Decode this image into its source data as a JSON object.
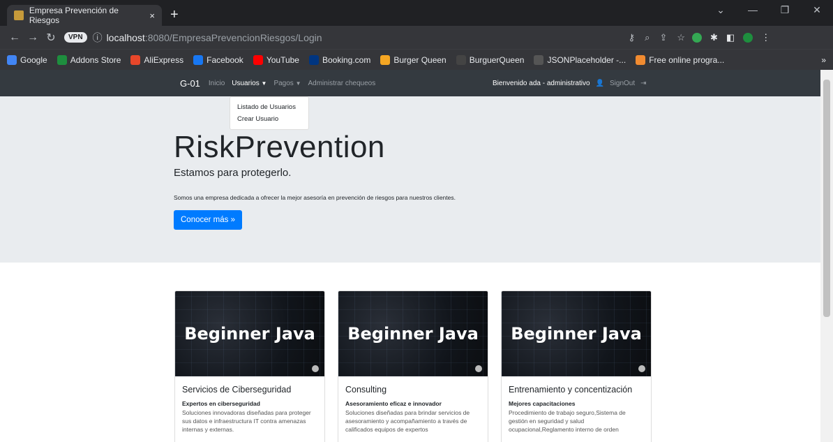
{
  "browser": {
    "tab_title": "Empresa Prevención de Riesgos",
    "tab_close": "×",
    "new_tab": "+",
    "url_host": "localhost",
    "url_path": ":8080/EmpresaPrevencionRiesgos/Login",
    "vpn_label": "VPN",
    "bookmarks": [
      {
        "label": "Google",
        "icon": "google-icon",
        "color": "#4285f4"
      },
      {
        "label": "Addons Store",
        "icon": "addons-icon",
        "color": "#1e8e3e"
      },
      {
        "label": "AliExpress",
        "icon": "aliexpress-icon",
        "color": "#e8472a"
      },
      {
        "label": "Facebook",
        "icon": "facebook-icon",
        "color": "#1877f2"
      },
      {
        "label": "YouTube",
        "icon": "youtube-icon",
        "color": "#ff0000"
      },
      {
        "label": "Booking.com",
        "icon": "booking-icon",
        "color": "#003580"
      },
      {
        "label": "Burger Queen",
        "icon": "burger-icon",
        "color": "#f5a623"
      },
      {
        "label": "BurguerQueen",
        "icon": "angular-icon",
        "color": "#444"
      },
      {
        "label": "JSONPlaceholder -...",
        "icon": "json-icon",
        "color": "#555"
      },
      {
        "label": "Free online progra...",
        "icon": "freecode-icon",
        "color": "#f28b30"
      }
    ],
    "more_bookmarks": "»"
  },
  "nav": {
    "brand": "G-01",
    "items": [
      "Inicio",
      "Usuarios",
      "Pagos",
      "Administrar chequeos"
    ],
    "welcome": "Bienvenido ada - administrativo",
    "signout": "SignOut"
  },
  "dropdown": [
    "Listado de Usuarios",
    "Crear Usuario"
  ],
  "hero": {
    "title": "RiskPrevention",
    "subtitle": "Estamos para protegerlo.",
    "text": "Somos una empresa dedicada a ofrecer la mejor asesoría en prevención de riesgos para nuestros clientes.",
    "button": "Conocer más »"
  },
  "cards": [
    {
      "image_text": "Beginner Java",
      "title": "Servicios de Ciberseguridad",
      "subtitle": "Expertos en ciberseguridad",
      "text": "Soluciones innovadoras diseñadas para proteger sus datos e infraestructura IT contra amenazas internas y externas."
    },
    {
      "image_text": "Beginner Java",
      "title": "Consulting",
      "subtitle": "Asesoramiento eficaz e innovador",
      "text": "Soluciones diseñadas para brindar servicios de asesoramiento y acompañamiento a través de calificados equipos de expertos"
    },
    {
      "image_text": "Beginner Java",
      "title": "Entrenamiento y concentización",
      "subtitle": "Mejores capacitaciones",
      "text": "Procedimiento de trabajo seguro,Sistema de gestión en seguridad y salud ocupacional,Reglamento interno de orden"
    }
  ]
}
